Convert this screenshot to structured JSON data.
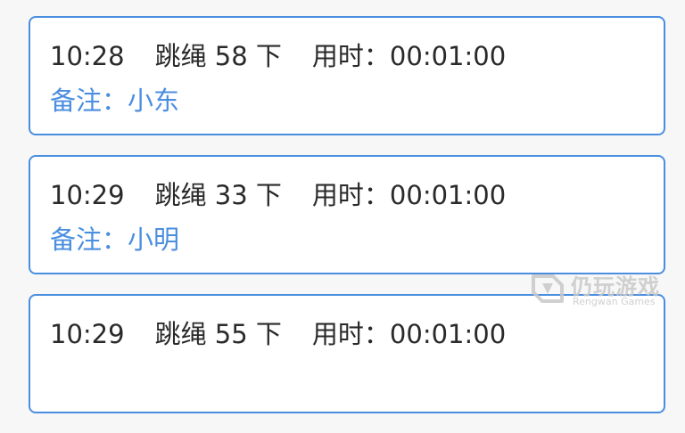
{
  "records": [
    {
      "time": "10:28",
      "count": "跳绳 58 下",
      "duration": "用时：00:01:00",
      "note": "备注：小东"
    },
    {
      "time": "10:29",
      "count": "跳绳 33 下",
      "duration": "用时：00:01:00",
      "note": "备注：小明"
    },
    {
      "time": "10:29",
      "count": "跳绳 55 下",
      "duration": "用时：00:01:00",
      "note": ""
    }
  ],
  "watermark": {
    "text": "仍玩游戏",
    "sub": "Rengwan Games"
  },
  "colors": {
    "accent": "#4a8ee0",
    "text": "#2a2a2a",
    "background": "#f7f7f7"
  }
}
